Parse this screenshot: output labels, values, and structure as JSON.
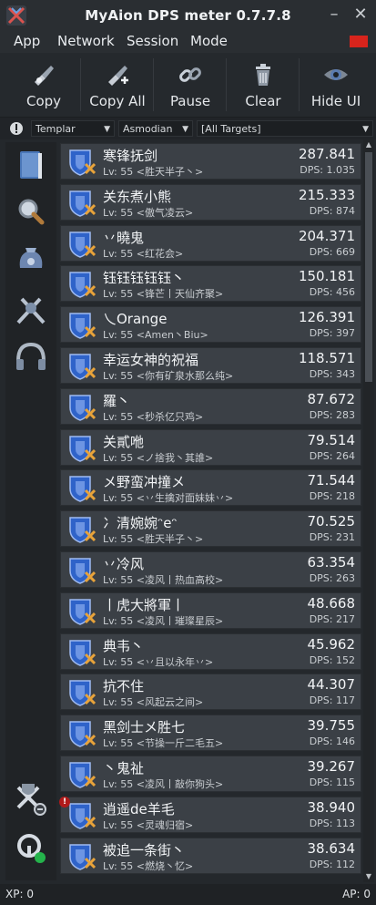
{
  "window": {
    "title": "MyAion DPS meter 0.7.7.8",
    "minimize_label": "–",
    "close_label": "✕"
  },
  "menu": [
    "App",
    "Network",
    "Session",
    "Mode"
  ],
  "toolbar": {
    "copy": "Copy",
    "copy_all": "Copy All",
    "pause": "Pause",
    "clear": "Clear",
    "hide_ui": "Hide UI"
  },
  "filters": {
    "class": "Templar",
    "race": "Asmodian",
    "target": "[All Targets]"
  },
  "rows": [
    {
      "name": "寒锋抚剑",
      "sub": "Lv: 55  <胜天半子丶>",
      "damage": "287.841",
      "dps": "DPS: 1.035"
    },
    {
      "name": "关东煮小熊",
      "sub": "Lv: 55  <傲气凌云>",
      "damage": "215.333",
      "dps": "DPS: 874"
    },
    {
      "name": "丷曉鬼",
      "sub": "Lv: 55  <红花会>",
      "damage": "204.371",
      "dps": "DPS: 669"
    },
    {
      "name": "钰钰钰钰钰丶",
      "sub": "Lv: 55  <锋芒丨天仙齐聚>",
      "damage": "150.181",
      "dps": "DPS: 456"
    },
    {
      "name": "乀Orange",
      "sub": "Lv: 55  <Amen丶Biu>",
      "damage": "126.391",
      "dps": "DPS: 397"
    },
    {
      "name": "幸运女神的祝福",
      "sub": "Lv: 55  <你有矿泉水那么纯>",
      "damage": "118.571",
      "dps": "DPS: 343"
    },
    {
      "name": "羅丶",
      "sub": "Lv: 55  <秒杀亿只鸡>",
      "damage": "87.672",
      "dps": "DPS: 283"
    },
    {
      "name": "关貳咃",
      "sub": "Lv: 55  <ノ捨我丶其誰>",
      "damage": "79.514",
      "dps": "DPS: 264"
    },
    {
      "name": "メ野蛮冲撞メ",
      "sub": "Lv: 55  <丷生擒对面妹妹丷>",
      "damage": "71.544",
      "dps": "DPS: 218"
    },
    {
      "name": "冫清婉婉ᵔeᵔ",
      "sub": "Lv: 55  <胜天半子丶>",
      "damage": "70.525",
      "dps": "DPS: 231"
    },
    {
      "name": "丷冷风",
      "sub": "Lv: 55  <凌风丨热血高校>",
      "damage": "63.354",
      "dps": "DPS: 263"
    },
    {
      "name": "丨虎大將軍丨",
      "sub": "Lv: 55  <凌风丨璀璨星辰>",
      "damage": "48.668",
      "dps": "DPS: 217"
    },
    {
      "name": "典韦丶",
      "sub": "Lv: 55  <丷且以永年丷>",
      "damage": "45.962",
      "dps": "DPS: 152"
    },
    {
      "name": "抗不住",
      "sub": "Lv: 55  <风起云之间>",
      "damage": "44.307",
      "dps": "DPS: 117"
    },
    {
      "name": "黑剑士メ胜七",
      "sub": "Lv: 55  <节操一斤二毛五>",
      "damage": "39.755",
      "dps": "DPS: 146"
    },
    {
      "name": "丶鬼祉",
      "sub": "Lv: 55  <凌风丨敲你狗头>",
      "damage": "39.267",
      "dps": "DPS: 115"
    },
    {
      "name": "逍遥de羊毛",
      "sub": "Lv: 55  <灵魂归宿>",
      "damage": "38.940",
      "dps": "DPS: 113",
      "alert": true
    },
    {
      "name": "被追一条街丶",
      "sub": "Lv: 55  <燃烧丶忆>",
      "damage": "38.634",
      "dps": "DPS: 112"
    }
  ],
  "status": {
    "xp": "XP: 0",
    "ap": "AP: 0"
  },
  "colors": {
    "background": "#24282c",
    "row": "#3b4046",
    "flag": "#d8241c",
    "templar_shield": "#2f63c9"
  }
}
